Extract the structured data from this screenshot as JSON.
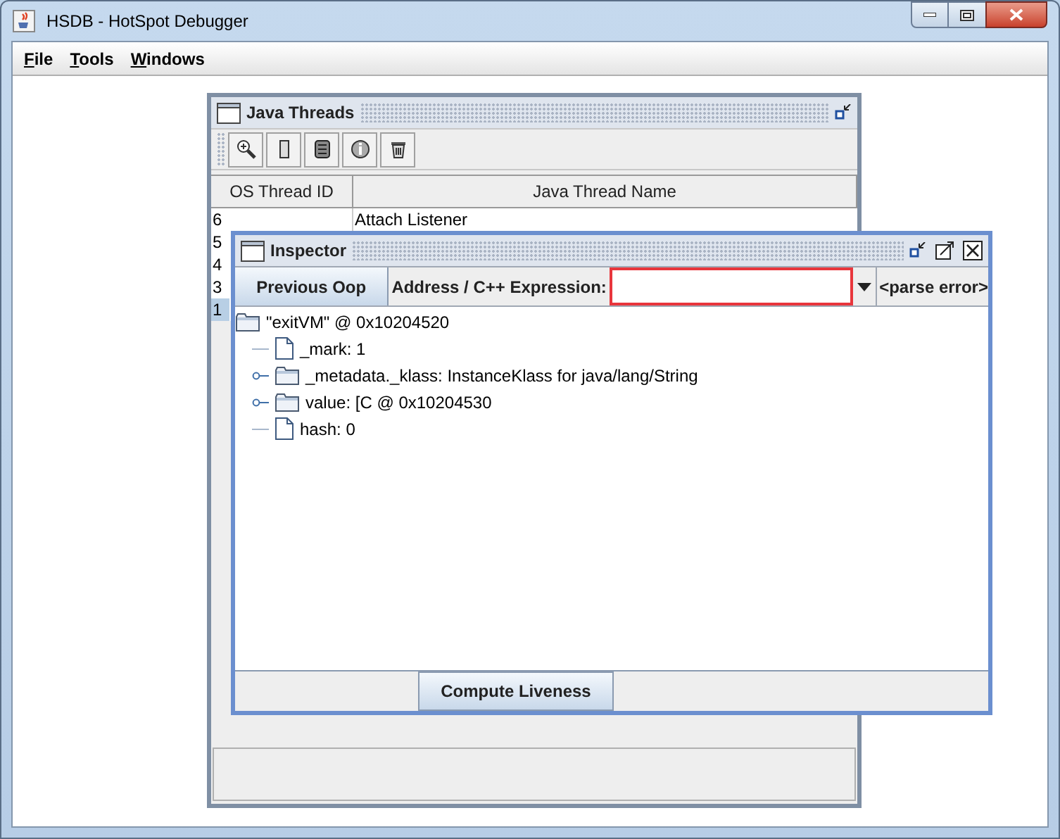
{
  "window": {
    "title": "HSDB - HotSpot Debugger"
  },
  "menu": [
    {
      "label": "File"
    },
    {
      "label": "Tools"
    },
    {
      "label": "Windows"
    }
  ],
  "threads_frame": {
    "title": "Java Threads",
    "columns": [
      "OS Thread ID",
      "Java Thread Name"
    ],
    "rows": [
      {
        "id": "6",
        "name": "Attach Listener",
        "selected": false
      },
      {
        "id": "5",
        "selected": false
      },
      {
        "id": "4",
        "selected": false
      },
      {
        "id": "3",
        "selected": false
      },
      {
        "id": "1",
        "selected": true
      }
    ]
  },
  "inspector": {
    "title": "Inspector",
    "previous_button": "Previous Oop",
    "address_label": "Address / C++ Expression:",
    "status": "<parse error>",
    "tree": {
      "label": "\"exitVM\" @ 0x10204520",
      "kind": "folder",
      "children": [
        {
          "label": "_mark: 1",
          "kind": "file"
        },
        {
          "label": "_metadata._klass: InstanceKlass for java/lang/String",
          "kind": "folder",
          "expanded": false
        },
        {
          "label": "value: [C @ 0x10204530",
          "kind": "folder",
          "expanded": false
        },
        {
          "label": "hash: 0",
          "kind": "file"
        }
      ]
    },
    "compute_button": "Compute Liveness"
  }
}
